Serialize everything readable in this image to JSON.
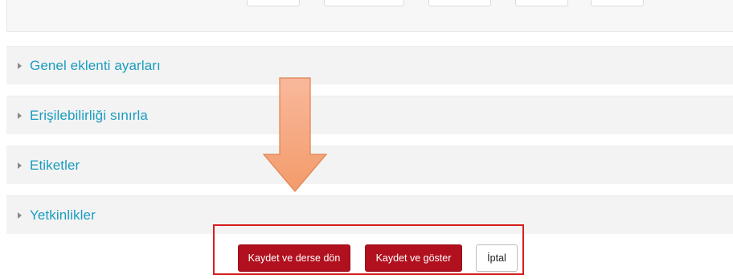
{
  "sections": [
    {
      "title": "Genel eklenti ayarları"
    },
    {
      "title": "Erişilebilirliği sınırla"
    },
    {
      "title": "Etiketler"
    },
    {
      "title": "Yetkinlikler"
    }
  ],
  "buttons": {
    "save_return": "Kaydet ve derse dön",
    "save_display": "Kaydet ve göster",
    "cancel": "İptal"
  },
  "colors": {
    "section_title": "#1a9cc0",
    "primary_button": "#b1101e",
    "highlight_border": "#d61e1e",
    "arrow_fill": "#f5a67f"
  }
}
